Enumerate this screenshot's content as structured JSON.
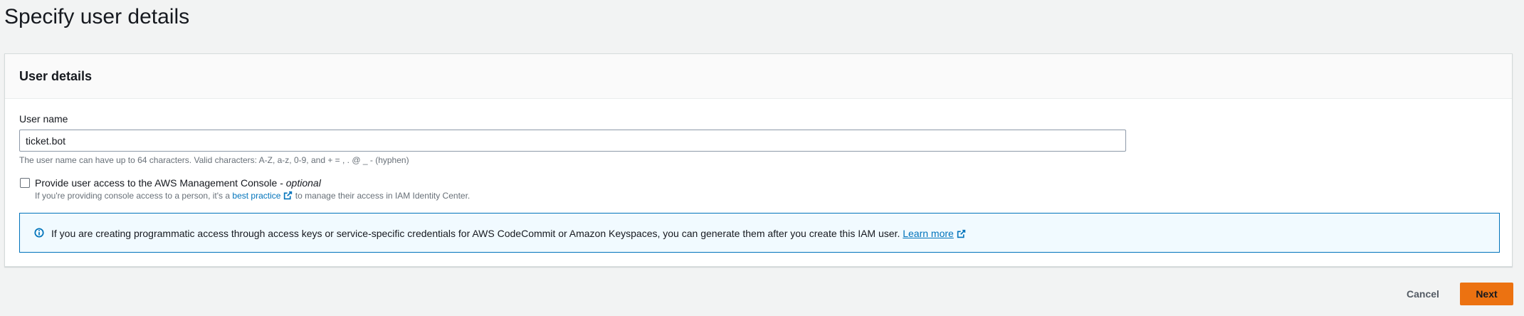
{
  "page": {
    "title": "Specify user details"
  },
  "user_details": {
    "title": "User details",
    "username_label": "User name",
    "username_value": "ticket.bot",
    "username_constraint": "The user name can have up to 64 characters. Valid characters: A-Z, a-z, 0-9, and + = , . @ _ - (hyphen)",
    "console_access": {
      "checked": false,
      "label": "Provide user access to the AWS Management Console - ",
      "optional": "optional",
      "desc_before": "If you're providing console access to a person, it's a ",
      "link": "best practice",
      "desc_after": " to manage their access in IAM Identity Center."
    }
  },
  "info_alert": {
    "text": "If you are creating programmatic access through access keys or service-specific credentials for AWS CodeCommit or Amazon Keyspaces, you can generate them after you create this IAM user. ",
    "link": "Learn more"
  },
  "footer": {
    "cancel_label": "Cancel",
    "next_label": "Next"
  },
  "colors": {
    "page_bg": "#f2f3f3",
    "link": "#0073bb",
    "primary_button": "#ec7211",
    "info_border": "#0073bb",
    "info_bg": "#f1faff"
  }
}
